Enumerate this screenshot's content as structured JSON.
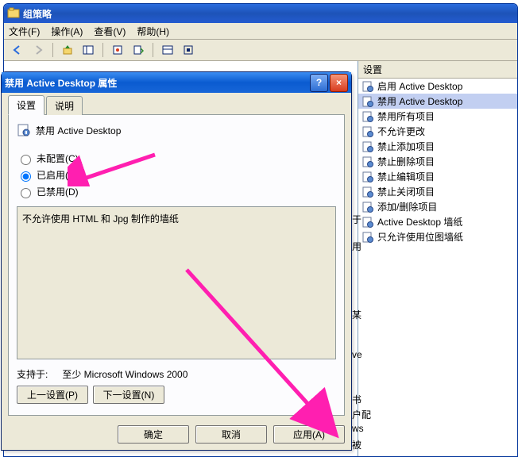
{
  "mainwin": {
    "title": "组策略",
    "menu": {
      "file": "文件(F)",
      "action": "操作(A)",
      "view": "查看(V)",
      "help": "帮助(H)"
    }
  },
  "rightpane": {
    "header": "设置",
    "items": [
      {
        "label": "启用 Active Desktop",
        "sel": false
      },
      {
        "label": "禁用 Active Desktop",
        "sel": true
      },
      {
        "label": "禁用所有项目",
        "sel": false
      },
      {
        "label": "不允许更改",
        "sel": false
      },
      {
        "label": "禁止添加项目",
        "sel": false
      },
      {
        "label": "禁止删除项目",
        "sel": false
      },
      {
        "label": "禁止编辑项目",
        "sel": false
      },
      {
        "label": "禁止关闭项目",
        "sel": false
      },
      {
        "label": "添加/删除项目",
        "sel": false
      },
      {
        "label": "Active Desktop 墙纸",
        "sel": false
      },
      {
        "label": "只允许使用位图墙纸",
        "sel": false
      }
    ]
  },
  "peek": {
    "a": "于",
    "b": "用",
    "c": "某",
    "d": "ve",
    "e": "书",
    "f": "户配",
    "g": "ws",
    "h": "被"
  },
  "dialog": {
    "title": "禁用 Active Desktop 属性",
    "tabs": {
      "settings": "设置",
      "explain": "说明"
    },
    "policy_name": "禁用 Active Desktop",
    "radios": {
      "not_configured": "未配置(C)",
      "enabled": "已启用(E)",
      "disabled": "已禁用(D)",
      "selected": "enabled"
    },
    "description": "不允许使用 HTML 和 Jpg 制作的墙纸",
    "supported_label": "支持于:",
    "supported_value": "至少 Microsoft Windows 2000",
    "prev": "上一设置(P)",
    "next": "下一设置(N)",
    "ok": "确定",
    "cancel": "取消",
    "apply": "应用(A)"
  }
}
